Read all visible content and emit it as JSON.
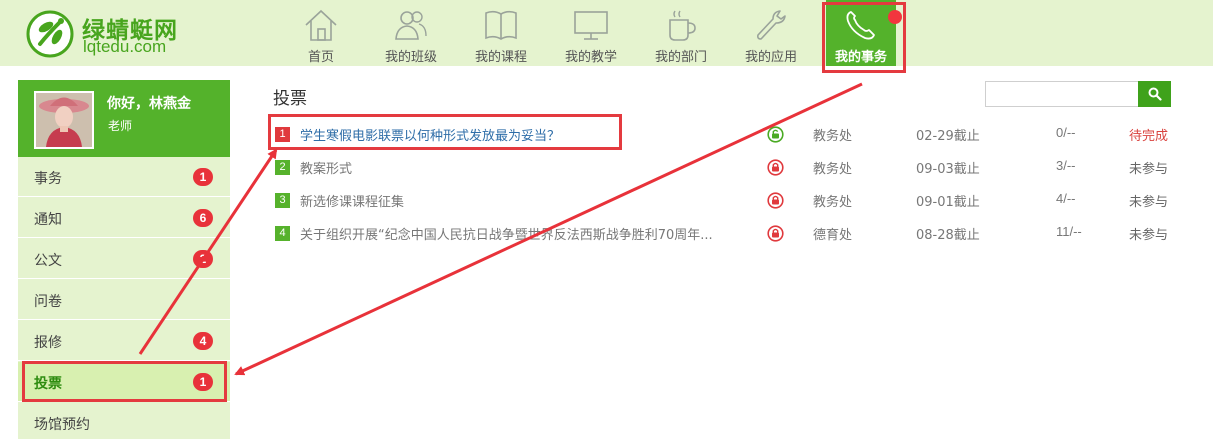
{
  "brand": {
    "name_cn": "绿蜻蜓网",
    "name_en": "lqtedu.com"
  },
  "nav": [
    {
      "label": "首页",
      "icon": "home-icon"
    },
    {
      "label": "我的班级",
      "icon": "people-icon"
    },
    {
      "label": "我的课程",
      "icon": "book-icon"
    },
    {
      "label": "我的教学",
      "icon": "monitor-icon"
    },
    {
      "label": "我的部门",
      "icon": "coffee-cup-icon"
    },
    {
      "label": "我的应用",
      "icon": "wrench-icon"
    },
    {
      "label": "我的事务",
      "icon": "phone-icon",
      "active": true,
      "notification": true
    }
  ],
  "user": {
    "greeting": "你好，林燕金",
    "role": "老师"
  },
  "sidebar": {
    "items": [
      {
        "label": "事务",
        "badge": "1"
      },
      {
        "label": "通知",
        "badge": "6"
      },
      {
        "label": "公文",
        "badge": "2"
      },
      {
        "label": "问卷",
        "badge": ""
      },
      {
        "label": "报修",
        "badge": "4"
      },
      {
        "label": "投票",
        "badge": "1",
        "active": true
      },
      {
        "label": "场馆预约",
        "badge": ""
      }
    ]
  },
  "main": {
    "title": "投票",
    "search": {
      "value": "",
      "placeholder": ""
    },
    "rows": [
      {
        "index": "1",
        "title": "学生寒假电影联票以何种形式发放最为妥当？",
        "dept": "教务处",
        "deadline": "02-29截止",
        "count": "0/--",
        "status": "待完成",
        "open": true
      },
      {
        "index": "2",
        "title": "教案形式",
        "dept": "教务处",
        "deadline": "09-03截止",
        "count": "3/--",
        "status": "未参与",
        "open": false
      },
      {
        "index": "3",
        "title": "新选修课课程征集",
        "dept": "教务处",
        "deadline": "09-01截止",
        "count": "4/--",
        "status": "未参与",
        "open": false
      },
      {
        "index": "4",
        "title": "关于组织开展“纪念中国人民抗日战争暨世界反法西斯战争胜利70周年...",
        "dept": "德育处",
        "deadline": "08-28截止",
        "count": "11/--",
        "status": "未参与",
        "open": false
      }
    ]
  },
  "colors": {
    "brand_green": "#54b22b",
    "header_bg": "#e5f3cf",
    "badge_red": "#e8323a",
    "annotation_red": "#e43a3f",
    "pending_red": "#d9433f",
    "link_blue": "#2f6ea8"
  }
}
